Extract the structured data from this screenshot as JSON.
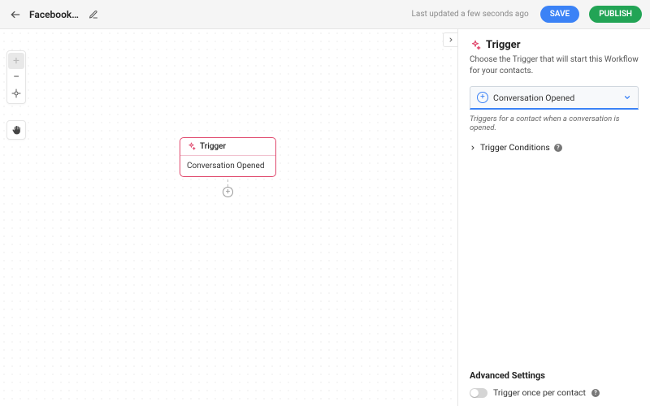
{
  "header": {
    "title": "Facebook…",
    "updated": "Last updated a few seconds ago",
    "save_label": "SAVE",
    "publish_label": "PUBLISH"
  },
  "canvas": {
    "node": {
      "header_label": "Trigger",
      "body_label": "Conversation Opened"
    }
  },
  "panel": {
    "title": "Trigger",
    "subtitle": "Choose the Trigger that will start this Workflow for your contacts.",
    "dropdown": {
      "selected": "Conversation Opened",
      "description": "Triggers for a contact when a conversation is opened."
    },
    "conditions_label": "Trigger Conditions",
    "advanced_title": "Advanced Settings",
    "toggle_label": "Trigger once per contact"
  }
}
